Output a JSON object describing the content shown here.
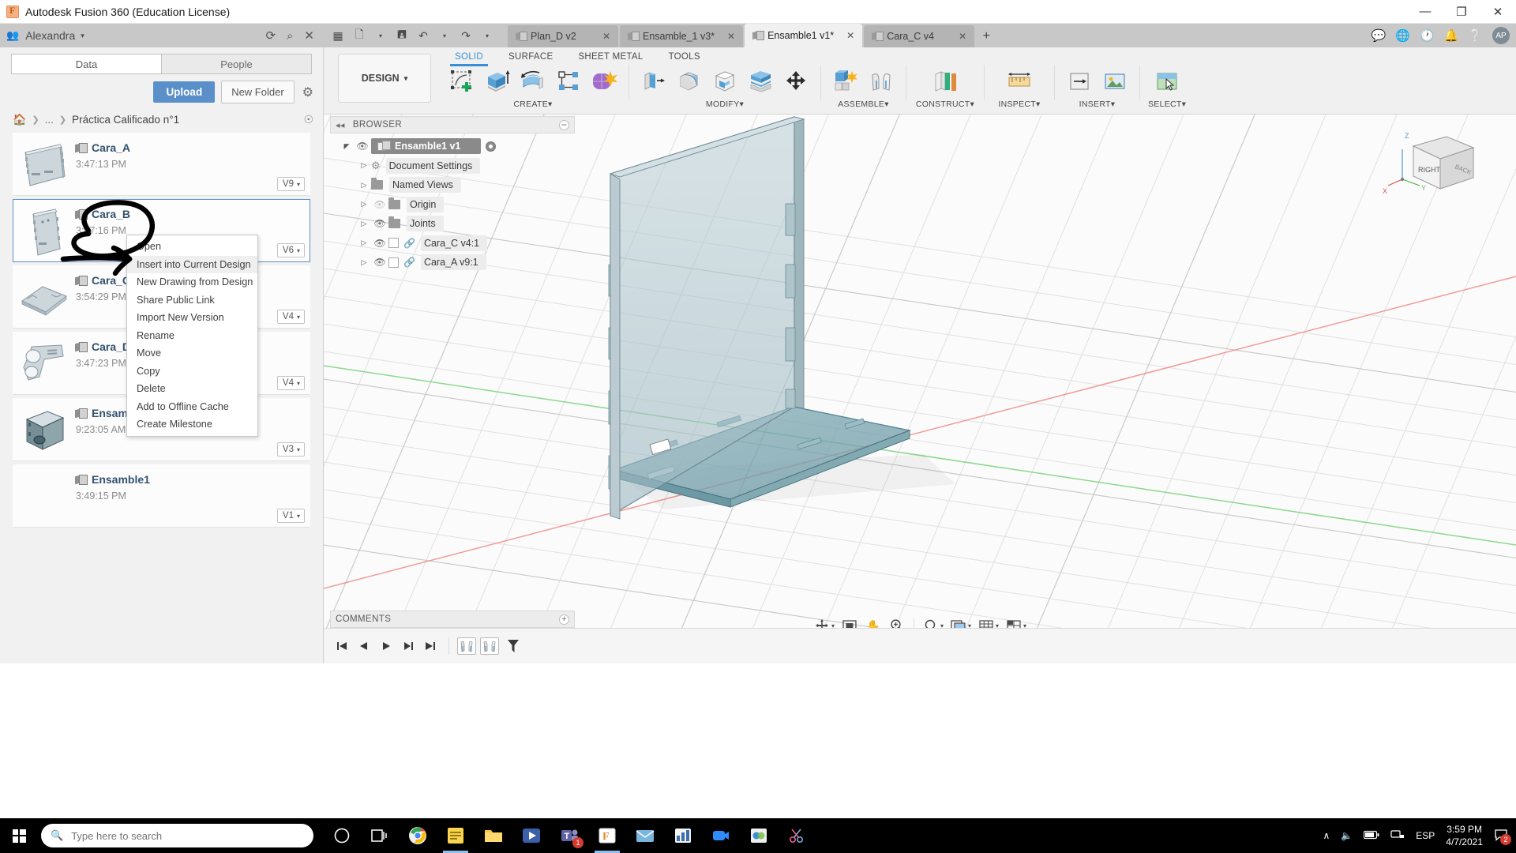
{
  "window": {
    "title": "Autodesk Fusion 360 (Education License)",
    "minimize": "—",
    "maximize": "❐",
    "close": "✕"
  },
  "userbar": {
    "people_icon": "people-icon",
    "username": "Alexandra",
    "caret": "▾",
    "refresh_icon": "⟳",
    "search_icon": "⌕",
    "close_icon": "✕"
  },
  "appbar": {
    "icons": [
      "grid-icon",
      "new-file-icon",
      "save-icon",
      "undo-icon",
      "redo-icon"
    ],
    "tabs": [
      {
        "label": "Plan_D v2",
        "active": false
      },
      {
        "label": "Ensamble_1 v3*",
        "active": false
      },
      {
        "label": "Ensamble1 v1*",
        "active": true
      },
      {
        "label": "Cara_C v4",
        "active": false
      }
    ],
    "add_tab": "+",
    "right_icons": [
      "comments-icon",
      "help-globe-icon",
      "clock-icon",
      "bell-icon",
      "question-icon"
    ],
    "avatar_initials": "AP"
  },
  "datapanel": {
    "tabs": [
      {
        "label": "Data",
        "active": true
      },
      {
        "label": "People",
        "active": false
      }
    ],
    "upload_label": "Upload",
    "new_folder_label": "New Folder",
    "settings_icon": "gear-icon",
    "breadcrumb": {
      "home_icon": "home-icon",
      "ellipsis": "...",
      "current": "Práctica Calificado n°1",
      "globe_icon": "globe-icon"
    },
    "items": [
      {
        "name": "Cara_A",
        "time": "3:47:13 PM",
        "version": "V9",
        "thumb": "plate-a",
        "selected": false
      },
      {
        "name": "Cara_B",
        "time": "3:47:16 PM",
        "version": "V6",
        "thumb": "plate-b",
        "selected": true
      },
      {
        "name": "Cara_C",
        "time": "3:54:29 PM",
        "version": "V4",
        "thumb": "plate-c",
        "selected": false
      },
      {
        "name": "Cara_D",
        "time": "3:47:23 PM",
        "version": "V4",
        "thumb": "bracket",
        "selected": false
      },
      {
        "name": "Ensamble_1",
        "time": "9:23:05 AM",
        "version": "V3",
        "thumb": "box",
        "selected": false
      },
      {
        "name": "Ensamble1",
        "time": "3:49:15 PM",
        "version": "V1",
        "thumb": "empty",
        "selected": false
      }
    ]
  },
  "context_menu": {
    "items": [
      {
        "label": "Open",
        "highlighted": false
      },
      {
        "label": "Insert into Current Design",
        "highlighted": true
      },
      {
        "label": "New Drawing from Design",
        "highlighted": false
      },
      {
        "label": "Share Public Link",
        "highlighted": false
      },
      {
        "label": "Import New Version",
        "highlighted": false
      },
      {
        "label": "Rename",
        "highlighted": false
      },
      {
        "label": "Move",
        "highlighted": false
      },
      {
        "label": "Copy",
        "highlighted": false
      },
      {
        "label": "Delete",
        "highlighted": false
      },
      {
        "label": "Add to Offline Cache",
        "highlighted": false
      },
      {
        "label": "Create Milestone",
        "highlighted": false
      }
    ]
  },
  "ribbon": {
    "workspace": "DESIGN",
    "workspace_caret": "▾",
    "tabs": [
      {
        "label": "SOLID",
        "active": true
      },
      {
        "label": "SURFACE",
        "active": false
      },
      {
        "label": "SHEET METAL",
        "active": false
      },
      {
        "label": "TOOLS",
        "active": false
      }
    ],
    "groups": [
      {
        "label": "CREATE",
        "caret": "▾",
        "icons": [
          "create-sketch-icon",
          "extrude-icon",
          "revolve-icon",
          "pattern-icon",
          "form-icon"
        ]
      },
      {
        "label": "MODIFY",
        "caret": "▾",
        "icons": [
          "press-pull-icon",
          "fillet-icon",
          "shell-icon",
          "offset-face-icon",
          "move-copy-icon"
        ]
      },
      {
        "label": "ASSEMBLE",
        "caret": "▾",
        "icons": [
          "new-component-icon",
          "joint-icon"
        ]
      },
      {
        "label": "CONSTRUCT",
        "caret": "▾",
        "icons": [
          "offset-plane-icon"
        ]
      },
      {
        "label": "INSPECT",
        "caret": "▾",
        "icons": [
          "measure-icon"
        ]
      },
      {
        "label": "INSERT",
        "caret": "▾",
        "icons": [
          "insert-derive-icon",
          "canvas-icon"
        ]
      },
      {
        "label": "SELECT",
        "caret": "▾",
        "icons": [
          "select-icon"
        ]
      }
    ]
  },
  "browser": {
    "header": "BROWSER",
    "collapse_icon": "◂◂",
    "minimize_icon": "−",
    "nodes": [
      {
        "label": "Ensamble1 v1",
        "root": true,
        "expanded": true,
        "eye": "on",
        "icon": "component-icon"
      },
      {
        "label": "Document Settings",
        "root": false,
        "expanded": false,
        "eye": "none",
        "icon": "gear-icon"
      },
      {
        "label": "Named Views",
        "root": false,
        "expanded": false,
        "eye": "none",
        "icon": "folder-icon"
      },
      {
        "label": "Origin",
        "root": false,
        "expanded": false,
        "eye": "off",
        "icon": "folder-icon"
      },
      {
        "label": "Joints",
        "root": false,
        "expanded": false,
        "eye": "on",
        "icon": "folder-icon"
      },
      {
        "label": "Cara_C v4:1",
        "root": false,
        "expanded": false,
        "eye": "on",
        "icon": "link-icon"
      },
      {
        "label": "Cara_A v9:1",
        "root": false,
        "expanded": false,
        "eye": "on",
        "icon": "link-icon"
      }
    ]
  },
  "viewcube": {
    "face_label": "RIGHT",
    "axis_x": "X",
    "axis_y": "Y",
    "axis_z": "Z"
  },
  "comments": {
    "label": "COMMENTS",
    "add_icon": "+"
  },
  "navbar": {
    "icons": [
      "orbit-icon",
      "fit-icon",
      "pan-icon",
      "zoom-icon",
      "look-at-icon",
      "display-settings-icon",
      "grid-snap-icon",
      "viewports-icon"
    ]
  },
  "timeline": {
    "buttons": [
      "skip-start-icon",
      "step-back-icon",
      "play-icon",
      "step-forward-icon",
      "skip-end-icon"
    ],
    "features": [
      "joint-feature-icon",
      "joint-feature-icon",
      "filter-icon"
    ]
  },
  "taskbar": {
    "start_icon": "windows-icon",
    "search_placeholder": "Type here to search",
    "search_icon": "search-icon",
    "apps": [
      "cortana-icon",
      "task-view-icon",
      "chrome-icon",
      "sticky-notes-icon",
      "file-explorer-icon",
      "media-player-icon",
      "teams-icon",
      "fusion360-icon",
      "mail-icon",
      "excel-icon",
      "zoom-icon",
      "autodesk-icon",
      "scissors-icon"
    ],
    "teams_badge": "1",
    "tray": {
      "chevron": "∧",
      "volume_icon": "🔊",
      "battery_icon": "battery-icon",
      "network_icon": "network-icon",
      "language": "ESP",
      "time": "3:59 PM",
      "date": "4/7/2021",
      "notification_count": "2"
    }
  }
}
